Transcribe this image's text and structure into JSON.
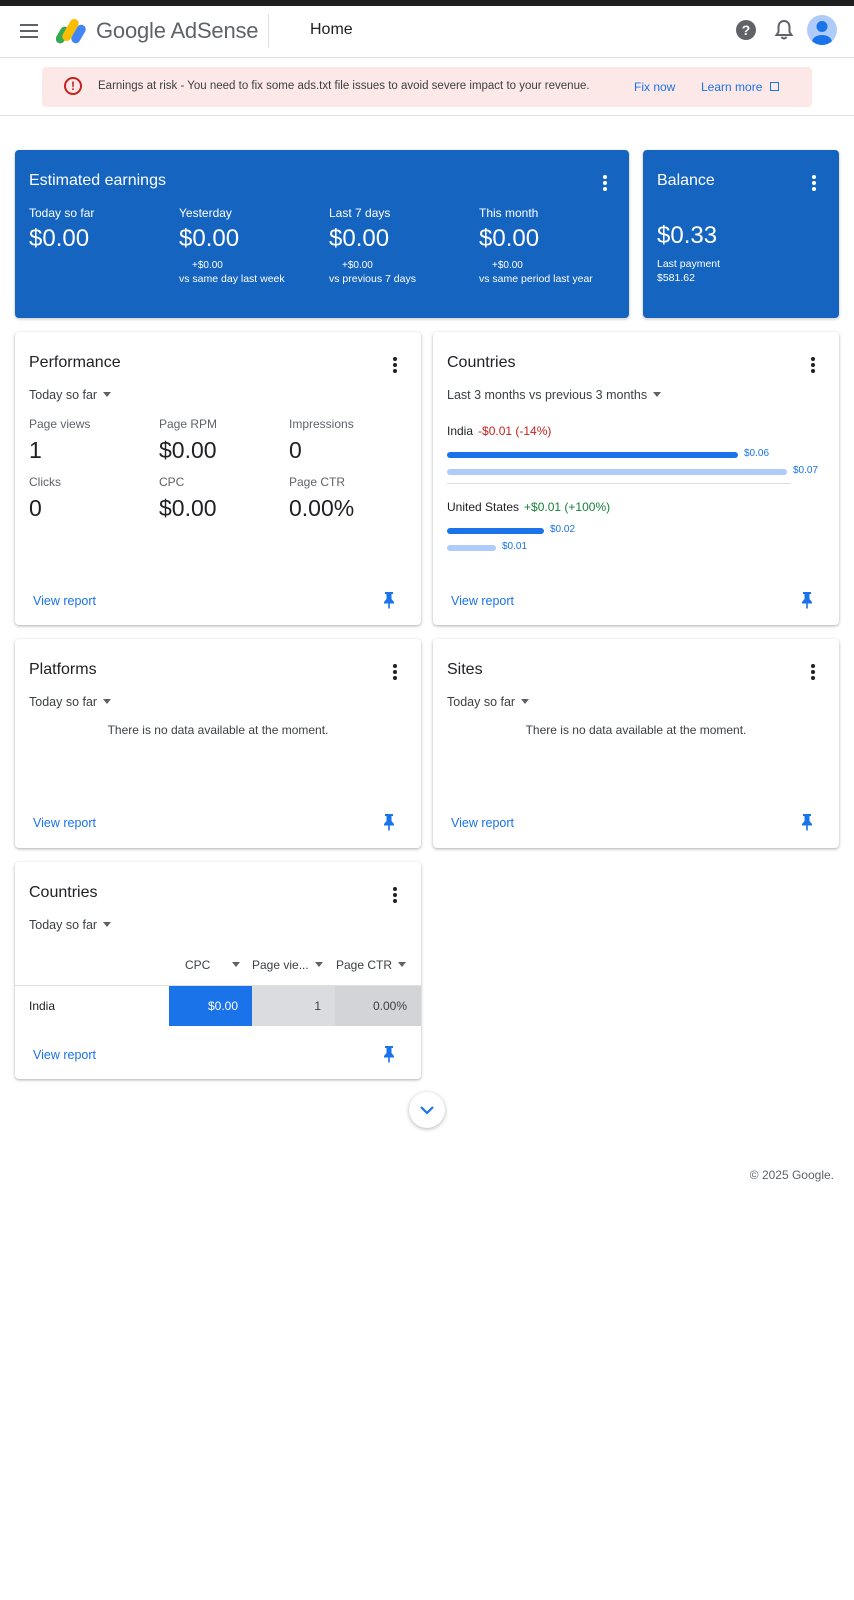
{
  "header": {
    "brand": "Google AdSense",
    "page_title": "Home",
    "icons": [
      "menu-icon",
      "help-icon",
      "bell-icon",
      "avatar-icon"
    ]
  },
  "alert": {
    "message": "Earnings at risk - You need to fix some ads.txt file issues to avoid severe impact to your revenue.",
    "fix_now": "Fix now",
    "learn_more": "Learn more"
  },
  "estimated_earnings": {
    "title": "Estimated earnings",
    "columns": [
      {
        "label": "Today so far",
        "value": "$0.00",
        "delta": "",
        "compare": ""
      },
      {
        "label": "Yesterday",
        "value": "$0.00",
        "delta": "+$0.00",
        "compare": "vs same day last week"
      },
      {
        "label": "Last 7 days",
        "value": "$0.00",
        "delta": "+$0.00",
        "compare": "vs previous 7 days"
      },
      {
        "label": "This month",
        "value": "$0.00",
        "delta": "+$0.00",
        "compare": "vs same period last year"
      }
    ]
  },
  "balance": {
    "title": "Balance",
    "value": "$0.33",
    "last_payment_label": "Last payment",
    "last_payment_value": "$581.62"
  },
  "performance": {
    "title": "Performance",
    "range": "Today so far",
    "metrics": [
      {
        "label": "Page views",
        "value": "1"
      },
      {
        "label": "Page RPM",
        "value": "$0.00"
      },
      {
        "label": "Impressions",
        "value": "0"
      },
      {
        "label": "Clicks",
        "value": "0"
      },
      {
        "label": "CPC",
        "value": "$0.00"
      },
      {
        "label": "Page CTR",
        "value": "0.00%"
      }
    ],
    "view_report": "View report"
  },
  "countries_chart": {
    "title": "Countries",
    "range": "Last 3 months vs previous 3 months",
    "view_report": "View report",
    "countries": [
      {
        "name": "India",
        "change": "-$0.01 (-14%)",
        "change_color": "#c5221f",
        "current_label": "$0.06",
        "previous_label": "$0.07",
        "current": 0.06,
        "previous": 0.07
      },
      {
        "name": "United States",
        "change": "+$0.01 (+100%)",
        "change_color": "#188038",
        "current_label": "$0.02",
        "previous_label": "$0.01",
        "current": 0.02,
        "previous": 0.01
      }
    ],
    "colors": {
      "current": "#1a73e8",
      "previous": "#aecbfa"
    }
  },
  "platforms": {
    "title": "Platforms",
    "range": "Today so far",
    "empty": "There is no data available at the moment.",
    "view_report": "View report"
  },
  "sites": {
    "title": "Sites",
    "range": "Today so far",
    "empty": "There is no data available at the moment.",
    "view_report": "View report"
  },
  "countries_table": {
    "title": "Countries",
    "range": "Today so far",
    "headers": [
      "CPC",
      "Page vie...",
      "Page CTR"
    ],
    "rows": [
      {
        "country": "India",
        "cpc": "$0.00",
        "page_views": "1",
        "page_ctr": "0.00%"
      }
    ],
    "view_report": "View report"
  },
  "footer": {
    "copyright": "© 2025 Google."
  },
  "theme": {
    "primary": "#1565c0",
    "link": "#1a73e8",
    "alert_bg": "#fce8e6"
  }
}
